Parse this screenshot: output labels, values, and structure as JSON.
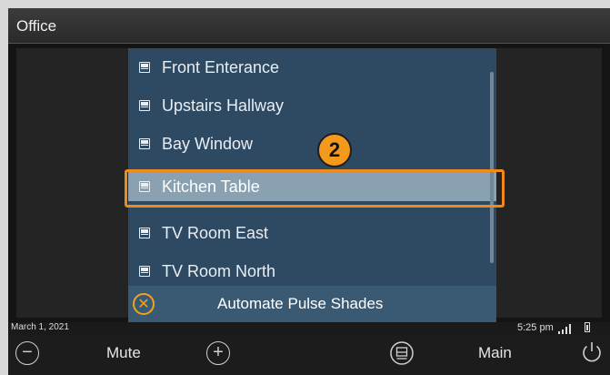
{
  "header": {
    "title": "Office"
  },
  "list": {
    "items": [
      {
        "label": "Front Enterance",
        "selected": false
      },
      {
        "label": "Upstairs Hallway",
        "selected": false
      },
      {
        "label": "Bay Window",
        "selected": false
      },
      {
        "label": "Kitchen Table",
        "selected": true
      },
      {
        "label": "TV Room East",
        "selected": false
      },
      {
        "label": "TV Room North",
        "selected": false
      }
    ],
    "callout_number": "2",
    "automate_label": "Automate Pulse Shades",
    "close_icon": "close-circle-icon"
  },
  "status": {
    "date": "March 1, 2021",
    "time": "5:25 pm"
  },
  "controls": {
    "mute_label": "Mute",
    "main_label": "Main",
    "minus_icon": "volume-down-icon",
    "plus_icon": "volume-up-icon",
    "shade_icon": "shade-icon",
    "power_icon": "power-icon"
  },
  "colors": {
    "panel_bg": "#2e4a63",
    "selected_bg": "#8aa1b2",
    "highlight": "#f08a1a",
    "badge": "#f39a1d"
  }
}
